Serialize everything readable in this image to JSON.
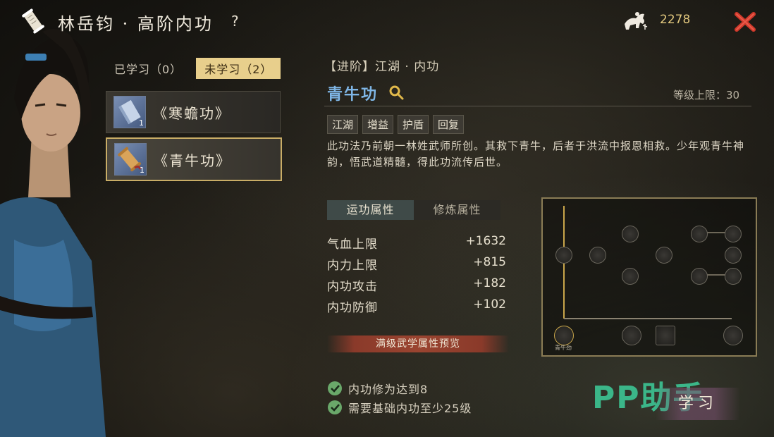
{
  "header": {
    "title": "林岳钧 · 高阶内功",
    "help": "?",
    "currency_amount": "2278",
    "icons": {
      "scroll": "scroll-icon",
      "currency": "horse-rider-icon",
      "close": "close-icon"
    }
  },
  "list": {
    "tabs": [
      {
        "label": "已学习（0）",
        "active": false
      },
      {
        "label": "未学习（2）",
        "active": true
      }
    ],
    "items": [
      {
        "name": "《寒蟾功》",
        "qty": "1",
        "selected": false
      },
      {
        "name": "《青牛功》",
        "qty": "1",
        "selected": true
      }
    ]
  },
  "detail": {
    "breadcrumb": "【进阶】江湖 · 内功",
    "name": "青牛功",
    "level_cap": "等级上限：30",
    "tags": [
      "江湖",
      "增益",
      "护盾",
      "回复"
    ],
    "description": "此功法乃前朝一林姓武师所创。其救下青牛，后者于洪流中报恩相救。少年观青牛神韵，悟武道精髓，得此功流传后世。",
    "attr_tabs": [
      {
        "label": "运功属性",
        "active": true
      },
      {
        "label": "修炼属性",
        "active": false
      }
    ],
    "attributes": [
      {
        "label": "气血上限",
        "value": "+1632"
      },
      {
        "label": "内力上限",
        "value": "+815"
      },
      {
        "label": "内功攻击",
        "value": "+182"
      },
      {
        "label": "内功防御",
        "value": "+102"
      }
    ],
    "preview_button": "满级武学属性预览",
    "requirements": [
      "内功修为达到8",
      "需要基础内功至少25级"
    ]
  },
  "tree": {
    "bottom_labels": [
      "青牛劲",
      "",
      "",
      ""
    ]
  },
  "actions": {
    "learn": "学习"
  },
  "watermark": "PP助手",
  "colors": {
    "accent_gold": "#e8cf8c",
    "skill_blue": "#7fb6e6",
    "close_red": "#d0392b",
    "check_green": "#6aa86a"
  }
}
